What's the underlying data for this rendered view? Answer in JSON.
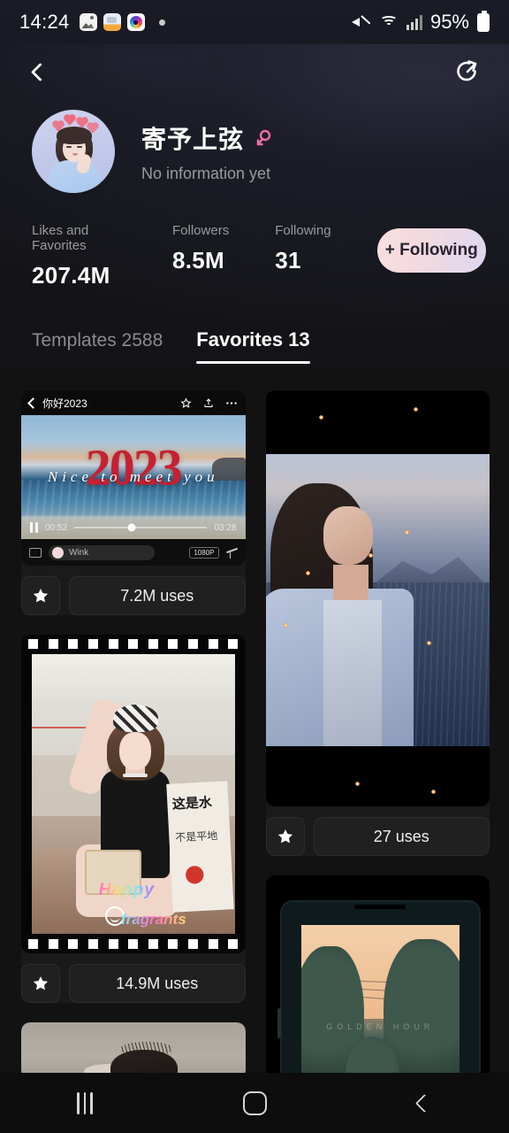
{
  "status_bar": {
    "time": "14:24",
    "battery_percent": "95%",
    "icons": [
      "image-notification-icon",
      "document-notification-icon",
      "camera-notification-icon",
      "dot-indicator",
      "mute-icon",
      "wifi-icon",
      "signal-icon",
      "battery-icon"
    ]
  },
  "nav": {
    "back_icon": "back-chevron-icon",
    "share_icon": "share-icon"
  },
  "profile": {
    "name": "寄予上弦",
    "gender_icon": "female-gender-icon",
    "bio": "No information yet",
    "avatar_alt": "illustrated-girl-avatar"
  },
  "stats": [
    {
      "label": "Likes and Favorites",
      "value": "207.4M"
    },
    {
      "label": "Followers",
      "value": "8.5M"
    },
    {
      "label": "Following",
      "value": "31"
    }
  ],
  "follow_button": {
    "label": "+ Following",
    "gradient_start": "#f8dfdd",
    "gradient_end": "#ddd6ef",
    "text_color": "#2a2330"
  },
  "tabs": [
    {
      "label": "Templates 2588",
      "active": false
    },
    {
      "label": "Favorites 13",
      "active": true
    }
  ],
  "cards": {
    "video_2023": {
      "header_title": "你好2023",
      "title_big": "2023",
      "subtitle": "Nice to meet you",
      "time_current": "00:52",
      "time_total": "03:28",
      "app_label": "Wink",
      "quality_badge": "1080P",
      "uses": "7.2M uses",
      "fav_icon": "star-filled-icon",
      "header_icons": [
        "star-outline-icon",
        "share-up-icon",
        "more-dots-icon"
      ]
    },
    "filmstrip": {
      "sign_text_1": "这是水",
      "sign_text_2": "不是平地",
      "overlay_text_1": "Happy",
      "overlay_text_2": "fragrants",
      "uses": "14.9M uses",
      "fav_icon": "star-filled-icon"
    },
    "portrait_sea": {
      "uses": "27 uses",
      "fav_icon": "star-filled-icon"
    },
    "sunset_trees": {
      "caption": "GOLDEN HOUR"
    },
    "partial": {}
  },
  "bottom_nav": {
    "items": [
      {
        "icon": "recent-apps-icon"
      },
      {
        "icon": "home-icon"
      },
      {
        "icon": "back-icon"
      }
    ]
  },
  "colors": {
    "background": "#121212",
    "card_background": "#202020",
    "accent_red": "#c62033"
  }
}
